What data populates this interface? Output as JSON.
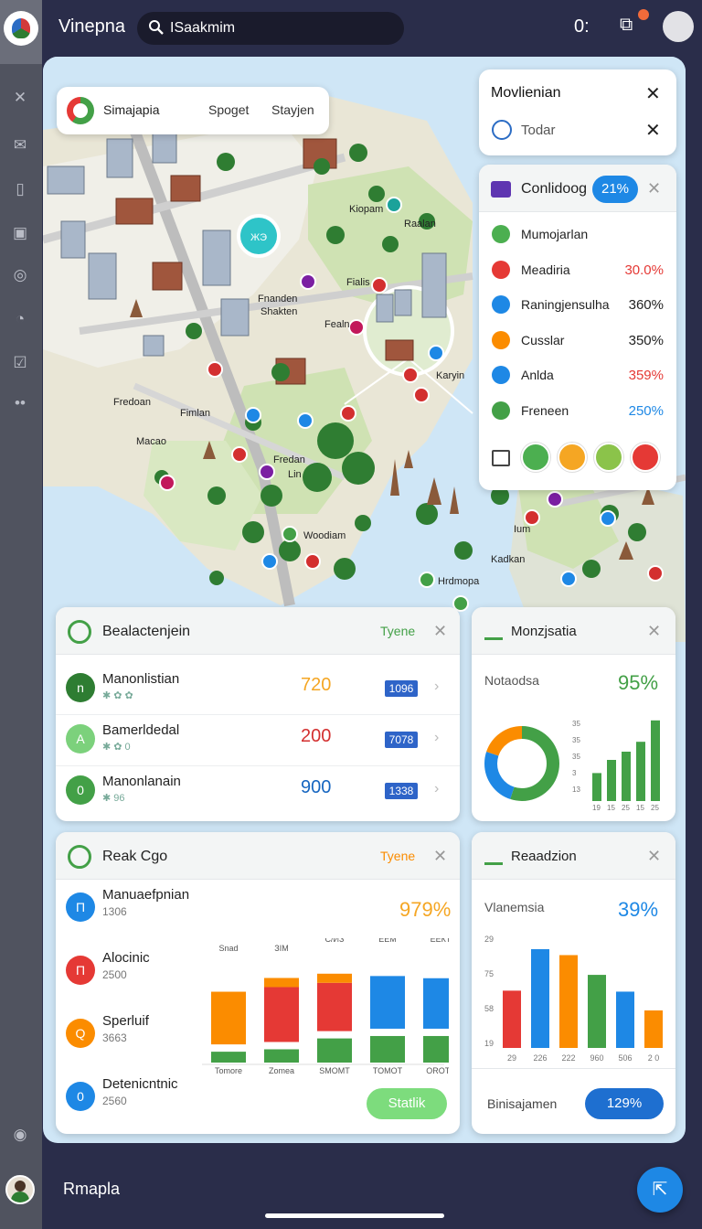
{
  "app": {
    "title": "Vinepna"
  },
  "search": {
    "value": "ISaakmim"
  },
  "header": {
    "counter": "0:"
  },
  "floating_tabs": {
    "title": "Simajapia",
    "tab1": "Spoget",
    "tab2": "Stayjen"
  },
  "map_labels": {
    "l1": "Kiopam",
    "l2": "Raalan",
    "l3": "Fialis",
    "l4": "Fnanden",
    "l5": "Shakten",
    "l6": "Fealn",
    "l7": "Fredoan",
    "l8": "Fimlan",
    "l9": "Macao",
    "l10": "Fredan",
    "l11": "Lin",
    "l12": "Woodiam",
    "l13": "Hrdmopa",
    "l14": "Kadkan",
    "l15": "Ium",
    "l16": "Karyin"
  },
  "map_pin": {
    "label": "ЖЭ"
  },
  "notice_card": {
    "title": "Movlienian",
    "subtitle": "Todar"
  },
  "legend_card": {
    "title": "Conlidoog",
    "badge": "21%",
    "items": [
      {
        "name": "Mumojarlan",
        "value": "",
        "color": "#4caf50"
      },
      {
        "name": "Meadiria",
        "value": "30.0%",
        "color": "#e53935"
      },
      {
        "name": "Raningjensulha",
        "value": "360%",
        "color": "#1e88e5"
      },
      {
        "name": "Cusslar",
        "value": "350%",
        "color": "#fb8c00"
      },
      {
        "name": "Anlda",
        "value": "359%",
        "color": "#1e88e5"
      },
      {
        "name": "Freneen",
        "value": "250%",
        "color": "#43a047"
      }
    ],
    "value_colors": [
      "#222",
      "#e53935",
      "#222",
      "#222",
      "#e53935",
      "#1e88e5"
    ]
  },
  "list_card": {
    "title": "Bealactenjein",
    "action": "Tyene",
    "rows": [
      {
        "name": "Manonlistian",
        "sub": "✱ ✿ ✿",
        "value": "720",
        "pill": "1096",
        "color": "#2e7d32",
        "initial": "n",
        "value_color": "#f5a623"
      },
      {
        "name": "Bamerldedal",
        "sub": "✱ ✿ 0",
        "value": "200",
        "pill": "7078",
        "color": "#7cd17c",
        "initial": "A",
        "value_color": "#d32f2f"
      },
      {
        "name": "Manonlanain",
        "sub": "✱ 96",
        "value": "900",
        "pill": "1338",
        "color": "#43a047",
        "initial": "0",
        "value_color": "#1565c0"
      }
    ]
  },
  "donut_card": {
    "title": "Monzjsatia",
    "metric_label": "Notaodsa",
    "metric_value": "95%",
    "y_ticks": [
      "35",
      "35",
      "35",
      "3",
      "13"
    ],
    "x_ticks": [
      "19",
      "15",
      "25",
      "15",
      "25"
    ],
    "bars": [
      0.34,
      0.5,
      0.6,
      0.72,
      0.98
    ],
    "donut": [
      {
        "value": 0.55,
        "color": "#43a047"
      },
      {
        "value": 0.25,
        "color": "#1e88e5"
      },
      {
        "value": 0.2,
        "color": "#fb8c00"
      }
    ]
  },
  "stack_card": {
    "title": "Reak Cgo",
    "action": "Tyene",
    "metric_value": "979%",
    "rows": [
      {
        "name": "Manuaefpnian",
        "sub": "1306",
        "color": "#1e88e5",
        "initial": "Π"
      },
      {
        "name": "Alocinic",
        "sub": "2500",
        "color": "#e53935",
        "initial": "П"
      },
      {
        "name": "Sperluif",
        "sub": "3663",
        "color": "#fb8c00",
        "initial": "Q"
      },
      {
        "name": "Detenicntnic",
        "sub": "2560",
        "color": "#1e88e5",
        "initial": "0"
      }
    ],
    "col_headers": [
      "Snad",
      "ЗIM",
      "С/ИЗ",
      "ЕЕМ",
      "ЕЕКТ"
    ],
    "col_labels": [
      "Tomore",
      "Zomea",
      "SMOMT",
      "TOMOT",
      "OROTZ"
    ],
    "columns": [
      {
        "top": {
          "value": 0.48,
          "color": "#fb8c00"
        },
        "bottom": {
          "value": 0.18,
          "color": "#43a047"
        }
      },
      {
        "top": {
          "value": 0.5,
          "color": "#e53935"
        },
        "bottom": {
          "value": 0.22,
          "color": "#43a047"
        },
        "cap": "#fb8c00"
      },
      {
        "top": {
          "value": 0.44,
          "color": "#e53935"
        },
        "bottom": {
          "value": 0.4,
          "color": "#43a047"
        },
        "cap": "#fb8c00"
      },
      {
        "top": {
          "value": 0.48,
          "color": "#1e88e5"
        },
        "bottom": {
          "value": 0.44,
          "color": "#43a047"
        }
      },
      {
        "top": {
          "value": 0.46,
          "color": "#1e88e5"
        },
        "bottom": {
          "value": 0.44,
          "color": "#43a047"
        }
      }
    ],
    "button": "Statlik"
  },
  "bar_card": {
    "title": "Reaadzion",
    "metric_label": "Vlanemsia",
    "metric_value": "39%",
    "y_ticks": [
      "29",
      "75",
      "58",
      "19"
    ],
    "x_ticks": [
      "29",
      "226",
      "222",
      "960",
      "506",
      "2 0"
    ],
    "bars": [
      {
        "value": 0.58,
        "color": "#e53935"
      },
      {
        "value": 1.0,
        "color": "#1e88e5"
      },
      {
        "value": 0.94,
        "color": "#fb8c00"
      },
      {
        "value": 0.74,
        "color": "#43a047"
      },
      {
        "value": 0.57,
        "color": "#1e88e5"
      },
      {
        "value": 0.38,
        "color": "#fb8c00"
      }
    ],
    "footer_label": "Binisajamen",
    "footer_value": "129%"
  },
  "footer": {
    "label": "Rmapla"
  }
}
